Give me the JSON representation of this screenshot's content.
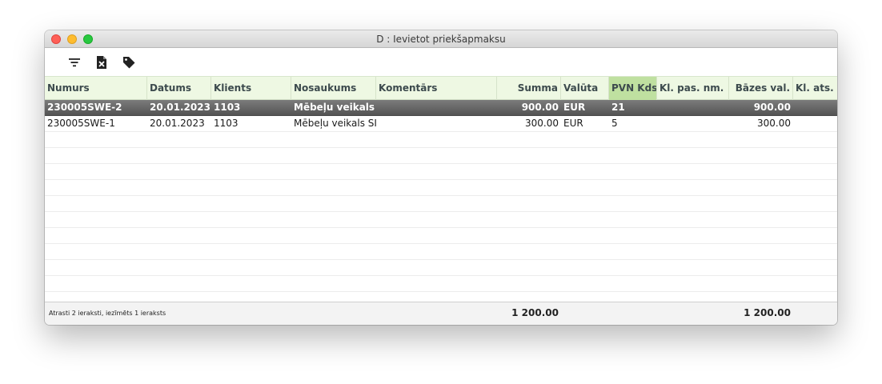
{
  "window": {
    "title": "D : Ievietot priekšapmaksu"
  },
  "toolbar": {
    "icons": [
      "filter-icon",
      "excel-export-icon",
      "tag-icon"
    ]
  },
  "table": {
    "columns": [
      "Numurs",
      "Datums",
      "Klients",
      "Nosaukums",
      "Komentārs",
      "Summa",
      "Valūta",
      "PVN Kds",
      "Kl. pas. nm.",
      "Bāzes val.",
      "Kl. ats."
    ],
    "active_column": "PVN Kds",
    "rows": [
      {
        "selected": true,
        "numurs": "230005SWE-2",
        "datums": "20.01.2023",
        "klients": "1103",
        "nosaukums": "Mēbeļu veikals S",
        "komentars": "",
        "summa": "900.00",
        "valuta": "EUR",
        "pvn": "21",
        "kl_pas": "",
        "bazes": "900.00",
        "kl_ats": ""
      },
      {
        "selected": false,
        "numurs": "230005SWE-1",
        "datums": "20.01.2023",
        "klients": "1103",
        "nosaukums": "Mēbeļu veikals SIA",
        "komentars": "",
        "summa": "300.00",
        "valuta": "EUR",
        "pvn": "5",
        "kl_pas": "",
        "bazes": "300.00",
        "kl_ats": ""
      }
    ]
  },
  "footer": {
    "status": "Atrasti 2 ieraksti, iezīmēts 1 ieraksts",
    "total_summa": "1 200.00",
    "total_bazes": "1 200.00"
  },
  "colors": {
    "header_bg": "#eef8e3",
    "active_header_bg": "#bfe0a0",
    "selected_row": "#5f5f5f"
  }
}
